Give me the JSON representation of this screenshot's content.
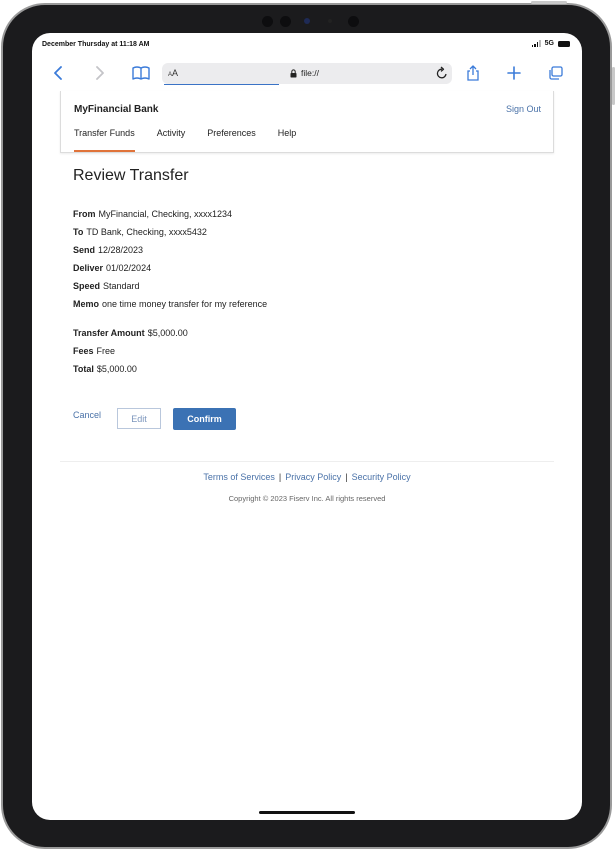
{
  "status_bar": {
    "time": "December Thursday at 11:18 AM",
    "network": "5G"
  },
  "browser": {
    "aa_label_small": "A",
    "aa_label_large": "A",
    "url": "file://",
    "icons": [
      "back-icon",
      "forward-icon",
      "bookmarks-icon",
      "lock-icon",
      "reload-icon",
      "share-icon",
      "new-tab-icon",
      "tabs-icon"
    ]
  },
  "bank": {
    "name": "MyFinancial Bank",
    "sign_out": "Sign Out",
    "tabs": [
      {
        "label": "Transfer Funds",
        "active": true
      },
      {
        "label": "Activity"
      },
      {
        "label": "Preferences"
      },
      {
        "label": "Help"
      }
    ],
    "accent_color": "#e0733a"
  },
  "review": {
    "title": "Review Transfer",
    "details": [
      {
        "label": "From",
        "value": "MyFinancial, Checking, xxxx1234"
      },
      {
        "label": "To",
        "value": "TD Bank, Checking, xxxx5432"
      },
      {
        "label": "Send",
        "value": "12/28/2023"
      },
      {
        "label": "Deliver",
        "value": "01/02/2024"
      },
      {
        "label": "Speed",
        "value": "Standard"
      },
      {
        "label": "Memo",
        "value": "one time money transfer for my reference"
      }
    ],
    "amounts": [
      {
        "label": "Transfer Amount",
        "value": "$5,000.00"
      },
      {
        "label": "Fees",
        "value": "Free"
      },
      {
        "label": "Total",
        "value": "$5,000.00"
      }
    ]
  },
  "actions": {
    "cancel": "Cancel",
    "edit": "Edit",
    "confirm": "Confirm",
    "confirm_color": "#3b72b4"
  },
  "footer": {
    "links": [
      "Terms of Services",
      "Privacy Policy",
      "Security Policy"
    ],
    "separator": "|",
    "copyright": "Copyright © 2023 Fiserv Inc. All rights reserved"
  }
}
